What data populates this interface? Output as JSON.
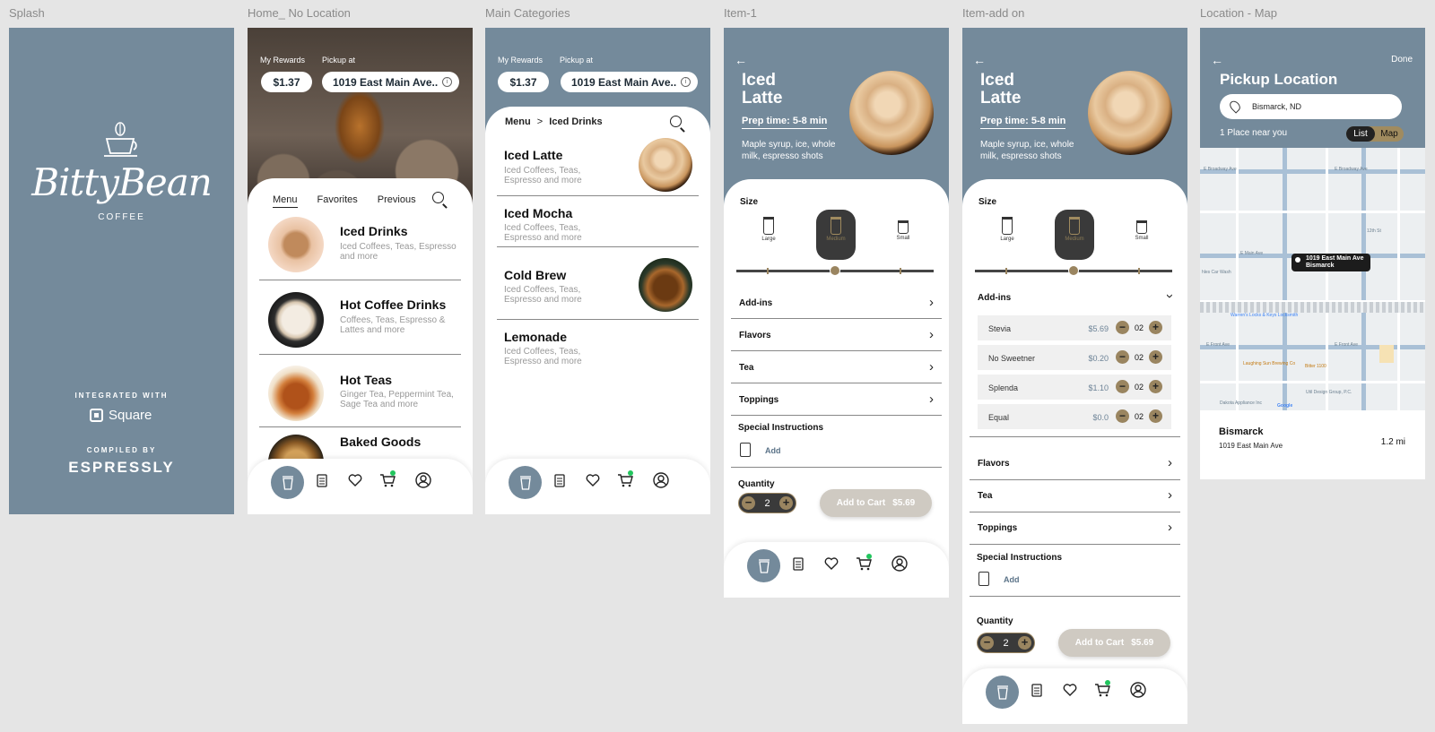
{
  "frames": {
    "splash": "Splash",
    "home": "Home_ No Location",
    "main": "Main Categories",
    "item1": "Item-1",
    "item2": "Item-add on",
    "location": "Location - Map"
  },
  "splash": {
    "logo": "BittyBean",
    "sub": "COFFEE",
    "integrated": "INTEGRATED WITH",
    "square": "Square",
    "compiled": "COMPILED BY",
    "espressly": "ESPRESSLY"
  },
  "header": {
    "rewards_label": "My Rewards",
    "pickup_label": "Pickup at",
    "rewards_value": "$1.37",
    "location_value": "1019 East Main Ave.."
  },
  "home": {
    "tabs": [
      "Menu",
      "Favorites",
      "Previous"
    ],
    "categories": [
      {
        "title": "Iced Drinks",
        "desc": "Iced Coffees, Teas, Espresso and more"
      },
      {
        "title": "Hot Coffee Drinks",
        "desc": "Coffees, Teas, Espresso & Lattes and more"
      },
      {
        "title": "Hot Teas",
        "desc": "Ginger Tea, Peppermint Tea, Sage Tea and more"
      },
      {
        "title": "Baked Goods",
        "desc": ""
      }
    ]
  },
  "main": {
    "crumb_root": "Menu",
    "crumb_sep": ">",
    "crumb_current": "Iced Drinks",
    "items": [
      {
        "title": "Iced Latte",
        "desc": "Iced Coffees, Teas, Espresso and more"
      },
      {
        "title": "Iced Mocha",
        "desc": "Iced Coffees, Teas, Espresso and more"
      },
      {
        "title": "Cold Brew",
        "desc": "Iced Coffees, Teas, Espresso and more"
      },
      {
        "title": "Lemonade",
        "desc": "Iced Coffees, Teas, Espresso and more"
      }
    ]
  },
  "item": {
    "back": "←",
    "title_line1": "Iced",
    "title_line2": "Latte",
    "prep": "Prep time: 5-8  min",
    "ingredients": "Maple syrup, ice, whole milk, espresso shots",
    "size_label": "Size",
    "sizes": [
      "Large",
      "Medium",
      "Small"
    ],
    "selected_size": "Medium",
    "rows": [
      "Add-ins",
      "Flavors",
      "Tea",
      "Toppings"
    ],
    "special_label": "Special Instructions",
    "special_add": "Add",
    "quantity_label": "Quantity",
    "quantity": "2",
    "cart_label": "Add to Cart",
    "cart_price": "$5.69",
    "chevron": "›"
  },
  "addons": {
    "items": [
      {
        "name": "Stevia",
        "price": "$5.69",
        "qty": "02"
      },
      {
        "name": "No Sweetner",
        "price": "$0.20",
        "qty": "02"
      },
      {
        "name": "Splenda",
        "price": "$1.10",
        "qty": "02"
      },
      {
        "name": "Equal",
        "price": "$0.0",
        "qty": "02"
      }
    ],
    "minus": "−",
    "plus": "+"
  },
  "nav": {
    "cart_badge": "3",
    "cart_badge_color": "#22c55e"
  },
  "location": {
    "back": "←",
    "done": "Done",
    "title": "Pickup Location",
    "search_value": "Bismarck, ND",
    "near": "1 Place near you",
    "toggle": [
      "List",
      "Map"
    ],
    "map_pin_line1": "1019 East Main Ave",
    "map_pin_line2": "Bismarck",
    "streets": [
      "E Broadway Ave",
      "E Main Ave",
      "E Front Ave",
      "12th St",
      "Laughing Sun Brewing Co",
      "Bitter 1100",
      "Util Design Group, P.C.",
      "Dakota Appliance Inc",
      "Warren's Locks & Keys Locksmith",
      "hles Car Wash",
      "Google"
    ],
    "card_name": "Bismarck",
    "card_addr": "1019 East Main Ave",
    "card_dist": "1.2 mi"
  },
  "colors": {
    "slate": "#748a9b",
    "gold": "#9a8560",
    "dark": "#3a3a3a"
  }
}
